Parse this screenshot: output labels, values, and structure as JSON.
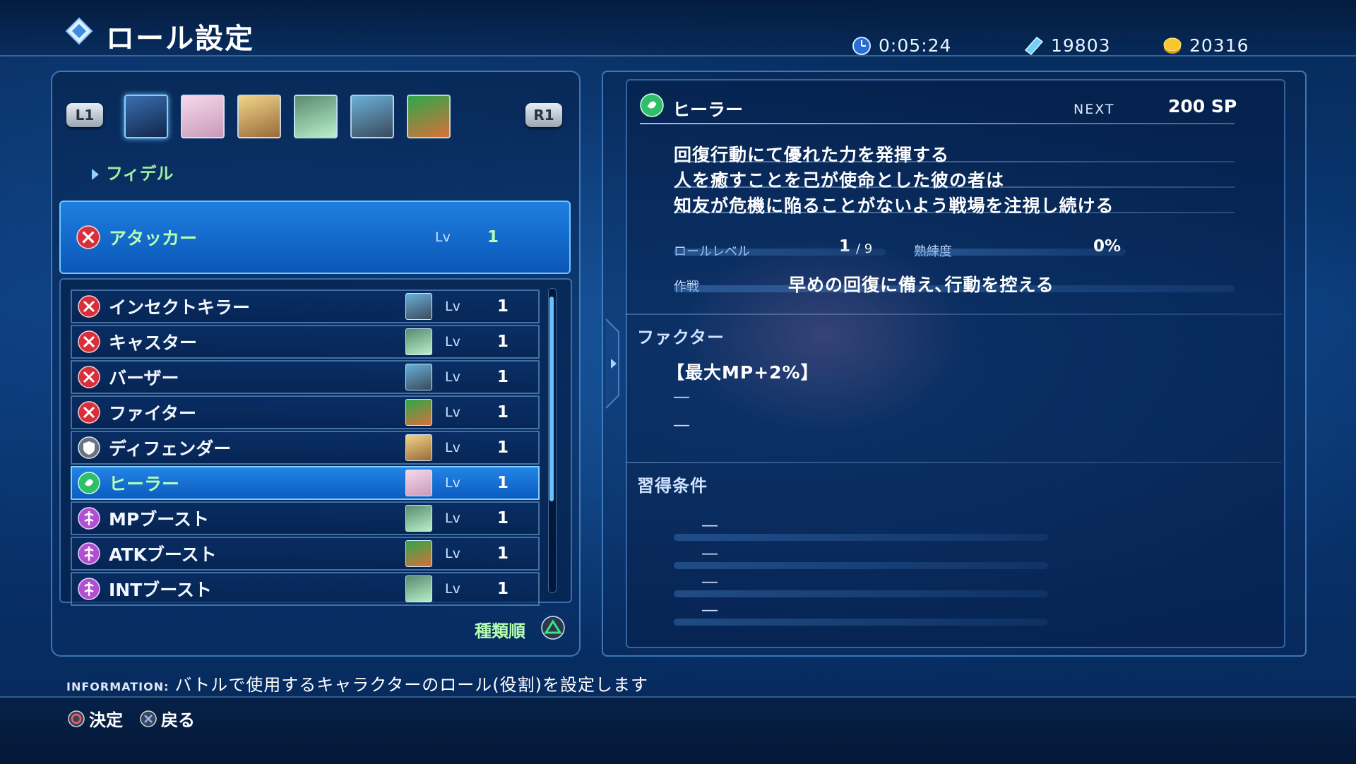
{
  "header": {
    "title": "ロール設定",
    "time": "0:05:24",
    "sp_total": "19803",
    "money": "20316"
  },
  "party": {
    "l1_label": "L1",
    "r1_label": "R1",
    "portraits": [
      "fidel-portrait",
      "miki-portrait",
      "victor-portrait",
      "fiore-portrait",
      "emmerson-portrait",
      "relia-portrait"
    ],
    "current_character": "フィデル"
  },
  "selected_role": {
    "name": "アタッカー",
    "lv_label": "Lv",
    "lv": "1"
  },
  "roles": [
    {
      "name": "インセクトキラー",
      "lv_label": "Lv",
      "lv": "1",
      "icon": "attack-role-icon",
      "face": "emmerson"
    },
    {
      "name": "キャスター",
      "lv_label": "Lv",
      "lv": "1",
      "icon": "attack-role-icon",
      "face": "fiore"
    },
    {
      "name": "バーザー",
      "lv_label": "Lv",
      "lv": "1",
      "icon": "attack-role-icon",
      "face": "emmerson"
    },
    {
      "name": "ファイター",
      "lv_label": "Lv",
      "lv": "1",
      "icon": "attack-role-icon",
      "face": "relia"
    },
    {
      "name": "ディフェンダー",
      "lv_label": "Lv",
      "lv": "1",
      "icon": "defend-role-icon",
      "face": "victor"
    },
    {
      "name": "ヒーラー",
      "lv_label": "Lv",
      "lv": "1",
      "icon": "heal-role-icon",
      "face": "miki"
    },
    {
      "name": "MPブースト",
      "lv_label": "Lv",
      "lv": "1",
      "icon": "boost-role-icon",
      "face": "fiore"
    },
    {
      "name": "ATKブースト",
      "lv_label": "Lv",
      "lv": "1",
      "icon": "boost-role-icon",
      "face": "relia"
    },
    {
      "name": "INTブースト",
      "lv_label": "Lv",
      "lv": "1",
      "icon": "boost-role-icon",
      "face": "fiore"
    }
  ],
  "sort_label": "種類順",
  "detail": {
    "role_name": "ヒーラー",
    "next_label": "NEXT",
    "next_value": "200 SP",
    "description": [
      "回復行動にて優れた力を発揮する",
      "人を癒すことを己が使命とした彼の者は",
      "知友が危機に陥ることがないよう戦場を注視し続ける"
    ],
    "role_level_label": "ロールレベル",
    "role_level_value": "1",
    "role_level_max": "/ 9",
    "proficiency_label": "熟練度",
    "proficiency_value": "0%",
    "strategy_label": "作戦",
    "strategy_value": "早めの回復に備え､行動を控える",
    "factor_title": "ファクター",
    "factors": [
      "【最大MP+2%】",
      "―",
      "―"
    ],
    "acquire_title": "習得条件",
    "conditions": [
      "―",
      "―",
      "―",
      "―"
    ]
  },
  "information": {
    "tag": "INFORMATION:",
    "text": "バトルで使用するキャラクターのロール(役割)を設定します"
  },
  "controls": {
    "confirm": "決定",
    "back": "戻る"
  },
  "colors": {
    "accent_green": "#b6ffb0",
    "highlight_blue": "#1f7fe0",
    "attack_icon": "#d8303a",
    "heal_icon": "#2fbf6a",
    "boost_icon": "#b04fd0"
  }
}
